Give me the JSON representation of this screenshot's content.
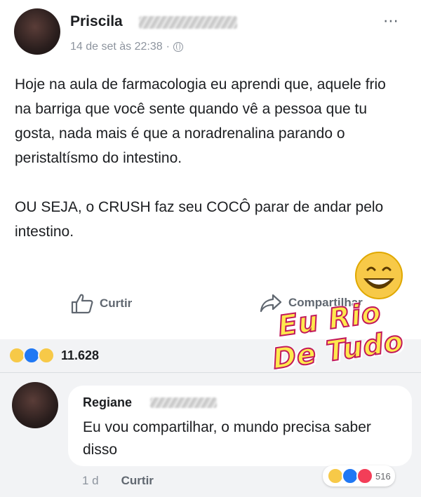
{
  "post": {
    "author": "Priscila",
    "timestamp": "14 de set às 22:38",
    "separator": "·",
    "more_icon": "⋯",
    "paragraphs": [
      "Hoje na aula de farmacologia eu aprendi que, aquele frio na barriga que você sente quando vê a pessoa que tu gosta, nada mais é que a noradrenalina parando o peristaltísmo do intestino.",
      "OU SEJA, o CRUSH faz seu COCÔ parar de andar pelo intestino."
    ],
    "like_label": "Curtir",
    "share_label": "Compartilhar",
    "reaction_count": "11.628",
    "reactions": [
      "haha",
      "like",
      "wow"
    ]
  },
  "watermark": {
    "line1": "Eu Rio",
    "line2": "De Tudo"
  },
  "comment": {
    "author": "Regiane",
    "text": "Eu vou compartilhar, o mundo precisa saber disso",
    "reaction_count": "516",
    "reactions": [
      "haha",
      "like",
      "love"
    ],
    "age": "1 d",
    "like_label": "Curtir"
  },
  "colors": {
    "like_blue": "#2078f4",
    "haha_yellow": "#f7c948",
    "love_red": "#f33e58",
    "meta_gray": "#8d949e",
    "watermark_fill": "#ffe94d",
    "watermark_stroke": "#c2185b"
  }
}
